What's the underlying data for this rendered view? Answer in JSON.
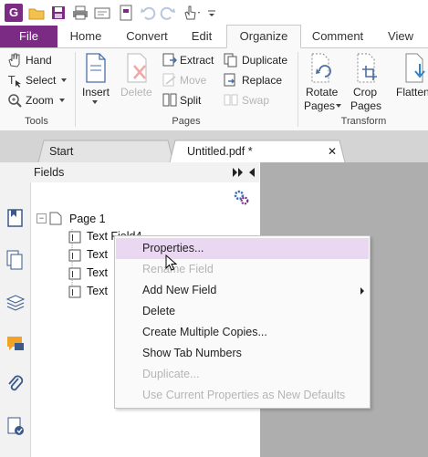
{
  "ribbon_tabs": {
    "file": "File",
    "home": "Home",
    "convert": "Convert",
    "edit": "Edit",
    "organize": "Organize",
    "comment": "Comment",
    "view": "View"
  },
  "tools_group": {
    "hand": "Hand",
    "select": "Select",
    "zoom": "Zoom",
    "label": "Tools"
  },
  "pages_group": {
    "insert": "Insert",
    "delete": "Delete",
    "extract": "Extract",
    "move": "Move",
    "split": "Split",
    "duplicate": "Duplicate",
    "replace": "Replace",
    "swap": "Swap",
    "label": "Pages"
  },
  "transform_group": {
    "rotate_line1": "Rotate",
    "rotate_line2": "Pages",
    "crop_line1": "Crop",
    "crop_line2": "Pages",
    "flatten": "Flatten",
    "label": "Transform"
  },
  "doc_tabs": {
    "start": "Start",
    "untitled": "Untitled.pdf *",
    "close_glyph": "✕"
  },
  "fields_panel": {
    "title": "Fields",
    "page_node": "Page 1",
    "expander": "−",
    "field_items": [
      "Text Field4",
      "Text",
      "Text",
      "Text"
    ]
  },
  "context_menu": {
    "items": [
      {
        "label": "Properties..."
      },
      {
        "label": "Rename Field"
      },
      {
        "label": "Add New Field"
      },
      {
        "label": "Delete"
      },
      {
        "label": "Create Multiple Copies..."
      },
      {
        "label": "Show Tab Numbers"
      },
      {
        "label": "Duplicate..."
      },
      {
        "label": "Use Current Properties as New Defaults"
      }
    ]
  },
  "colors": {
    "accent": "#7b2b83",
    "menu_highlight": "#ead7f1",
    "doc_background": "#aeaeae"
  }
}
